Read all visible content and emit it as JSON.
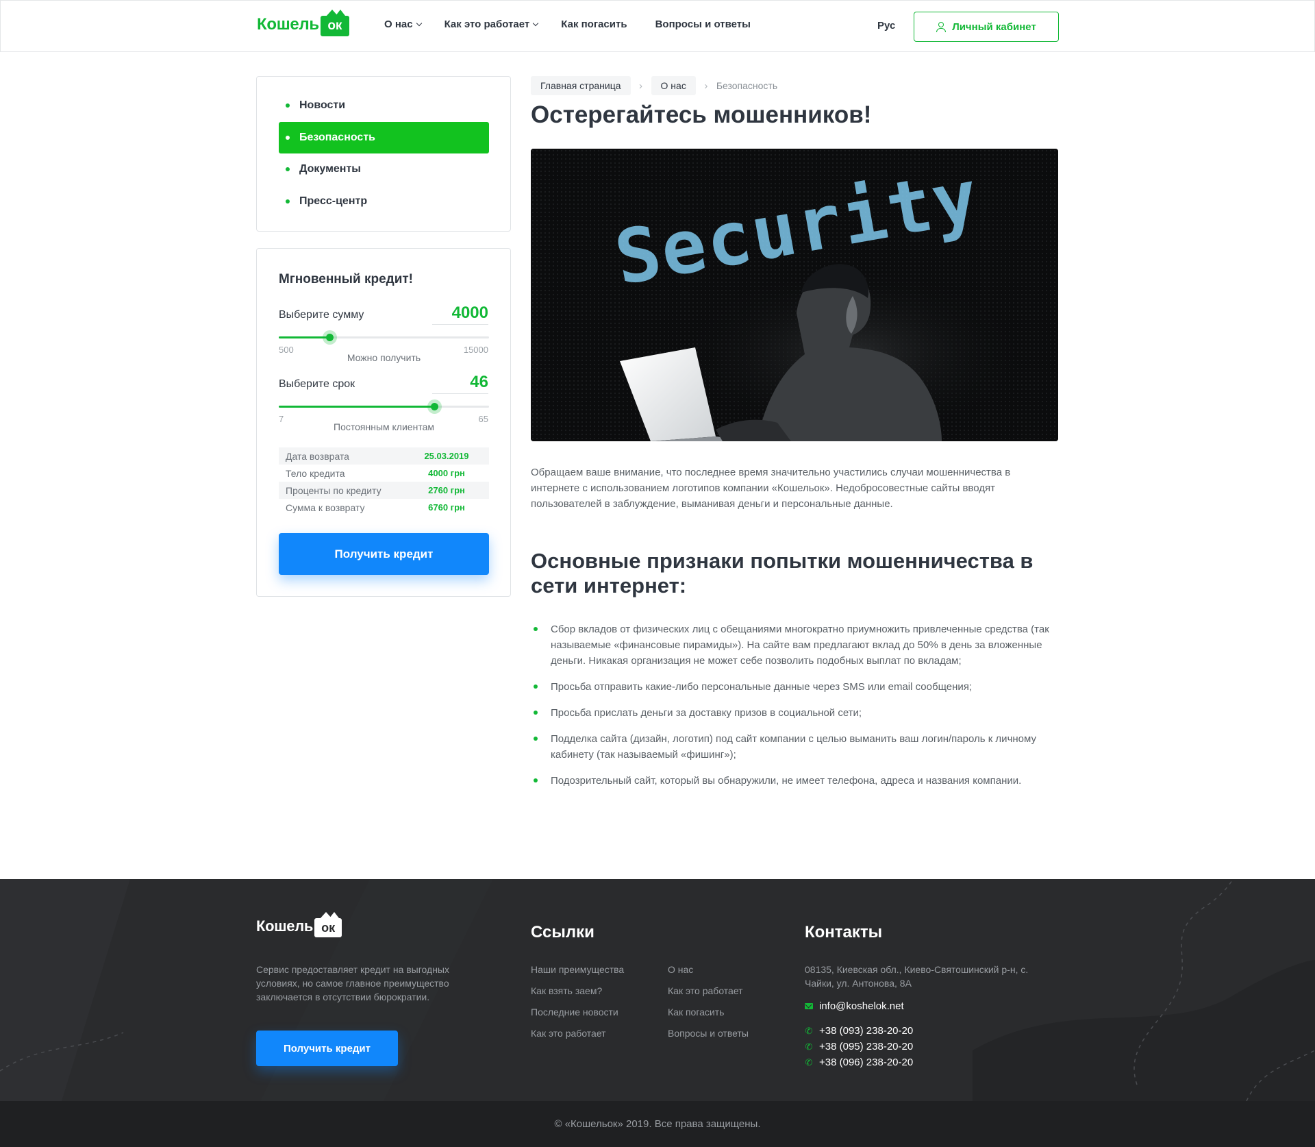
{
  "header": {
    "logo_text": "Кошель",
    "logo_badge": "ок",
    "nav": [
      {
        "label": "О нас",
        "has_dropdown": true
      },
      {
        "label": "Как это работает",
        "has_dropdown": true
      },
      {
        "label": "Как погасить",
        "has_dropdown": false
      },
      {
        "label": "Вопросы и ответы",
        "has_dropdown": false
      }
    ],
    "language": "Рус",
    "cabinet_label": "Личный кабинет"
  },
  "sidebar": {
    "items": [
      {
        "label": "Новости",
        "active": false
      },
      {
        "label": "Безопасность",
        "active": true
      },
      {
        "label": "Документы",
        "active": false
      },
      {
        "label": "Пресс-центр",
        "active": false
      }
    ]
  },
  "calculator": {
    "title": "Мгновенный кредит!",
    "amount": {
      "label": "Выберите сумму",
      "value": "4000",
      "min": "500",
      "max": "15000",
      "note": "Можно получить",
      "fraction": 0.24
    },
    "term": {
      "label": "Выберите срок",
      "value": "46",
      "min": "7",
      "max": "65",
      "note": "Постоянным клиентам",
      "fraction": 0.74
    },
    "summary": [
      {
        "key": "Дата возврата",
        "value": "25.03.2019"
      },
      {
        "key": "Тело кредита",
        "value": "4000 грн"
      },
      {
        "key": "Проценты по кредиту",
        "value": "2760 грн"
      },
      {
        "key": "Сумма к возврату",
        "value": "6760 грн"
      }
    ],
    "button": "Получить кредит"
  },
  "breadcrumb": {
    "items": [
      "Главная страница",
      "О нас"
    ],
    "current": "Безопасность"
  },
  "main": {
    "title": "Остерегайтесь мошенников!",
    "hero_word": "Security",
    "intro": "Обращаем ваше внимание, что последнее время значительно участились случаи мошенничества в интернете с использованием логотипов компании «Кошельок». Недобросовестные сайты вводят пользователей в заблуждение, выманивая деньги и персональные данные.",
    "subtitle": "Основные признаки попытки мошенничества в сети интернет:",
    "signs": [
      "Сбор вкладов от физических лиц с обещаниями многократно приумножить привлеченные средства (так называемые «финансовые пирамиды»). На сайте вам предлагают вклад до 50% в день за вложенные деньги. Никакая организация не может себе позволить подобных выплат по вкладам;",
      "Просьба отправить какие-либо персональные данные через SMS или email сообщения;",
      "Просьба прислать деньги за доставку призов в социальной сети;",
      "Подделка сайта (дизайн, логотип) под сайт компании с целью выманить ваш логин/пароль к личному кабинету (так называемый «фишинг»);",
      "Подозрительный сайт, который вы обнаружили, не имеет телефона, адреса и названия компании."
    ]
  },
  "footer": {
    "description": "Сервис предоставляет кредит на выгодных условиях, но самое главное преимущество заключается в отсутствии бюрократии.",
    "button": "Получить кредит",
    "links_title": "Ссылки",
    "links_col1": [
      "Наши преимущества",
      "Как взять заем?",
      "Последние новости",
      "Как это работает"
    ],
    "links_col2": [
      "О нас",
      "Как это работает",
      "Как погасить",
      "Вопросы и ответы"
    ],
    "contacts_title": "Контакты",
    "address": "08135, Киевская обл., Киево-Святошинский р-н, с. Чайки, ул. Антонова, 8А",
    "email": "info@koshelok.net",
    "phones": [
      "+38 (093) 238-20-20",
      "+38 (095) 238-20-20",
      "+38 (096) 238-20-20"
    ],
    "copyright": "© «Кошельок» 2019. Все права защищены."
  },
  "colors": {
    "brand_green": "#12b836",
    "accent_blue": "#1187fb",
    "text_dark": "#2f3640",
    "footer_bg": "#2a2b2d"
  }
}
